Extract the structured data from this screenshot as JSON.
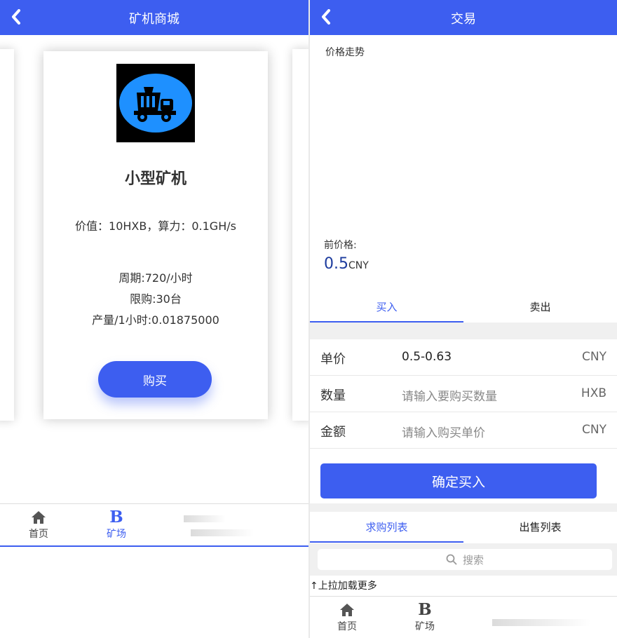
{
  "left": {
    "title": "矿机商城",
    "card": {
      "name": "小型矿机",
      "value_line": "价值：10HXB，算力：0.1GH/s",
      "cycle": "周期:720/小时",
      "limit": "限购:30台",
      "output": "产量/1小时:0.01875000",
      "buy_label": "购买"
    },
    "tabbar": [
      {
        "label": "首页",
        "icon": "home-icon"
      },
      {
        "label": "矿场",
        "icon": "b-letter-icon"
      }
    ]
  },
  "right": {
    "title": "交易",
    "chart_title": "价格走势",
    "current_price_label": "前价格:",
    "current_price_value": "0.5",
    "current_price_unit": "CNY",
    "trade_tabs": {
      "buy": "买入",
      "sell": "卖出"
    },
    "form": {
      "unit_price": {
        "label": "单价",
        "value": "0.5-0.63",
        "unit": "CNY"
      },
      "quantity": {
        "label": "数量",
        "placeholder": "请输入要购买数量",
        "unit": "HXB"
      },
      "amount": {
        "label": "金额",
        "placeholder": "请输入购买单价",
        "unit": "CNY"
      }
    },
    "confirm_label": "确定买入",
    "list_tabs": {
      "buy_list": "求购列表",
      "sell_list": "出售列表"
    },
    "search_placeholder": "搜索",
    "load_more": "↑上拉加载更多",
    "tabbar": [
      {
        "label": "首页",
        "icon": "home-icon"
      },
      {
        "label": "矿场",
        "icon": "b-letter-icon"
      }
    ]
  },
  "colors": {
    "accent": "#3d5ef0",
    "price": "#1d3c9e",
    "background": "#ffffff"
  }
}
